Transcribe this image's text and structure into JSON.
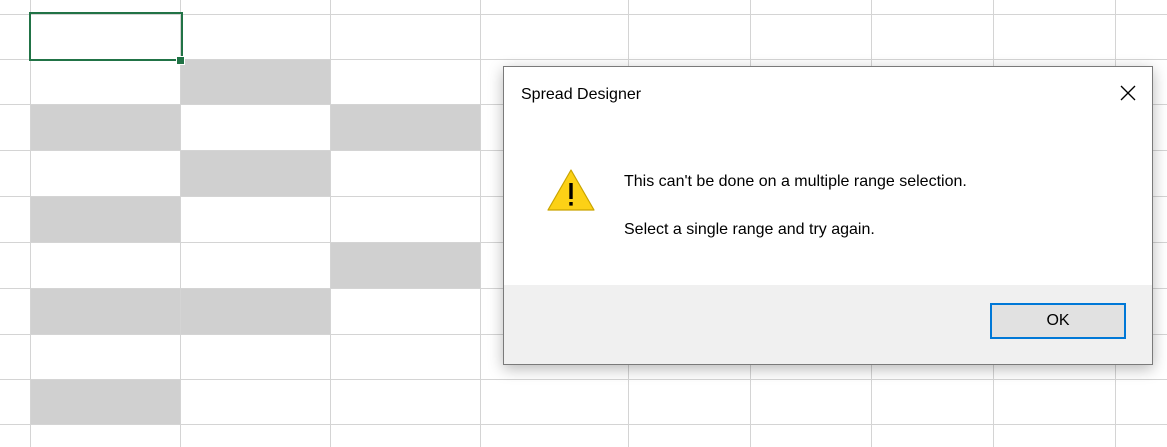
{
  "dialog": {
    "title": "Spread Designer",
    "message_line1": "This can't be done on a multiple range selection.",
    "message_line2": "Select a single range and try again.",
    "ok_label": "OK",
    "icon": "warning-icon",
    "close_icon": "close-icon"
  },
  "colors": {
    "grid_line": "#d4d4d4",
    "selected_range": "#d0d0d0",
    "active_cell_border": "#217346",
    "dialog_footer": "#f0f0f0",
    "ok_button_border": "#0078d7",
    "warning_yellow": "#fcd116"
  }
}
